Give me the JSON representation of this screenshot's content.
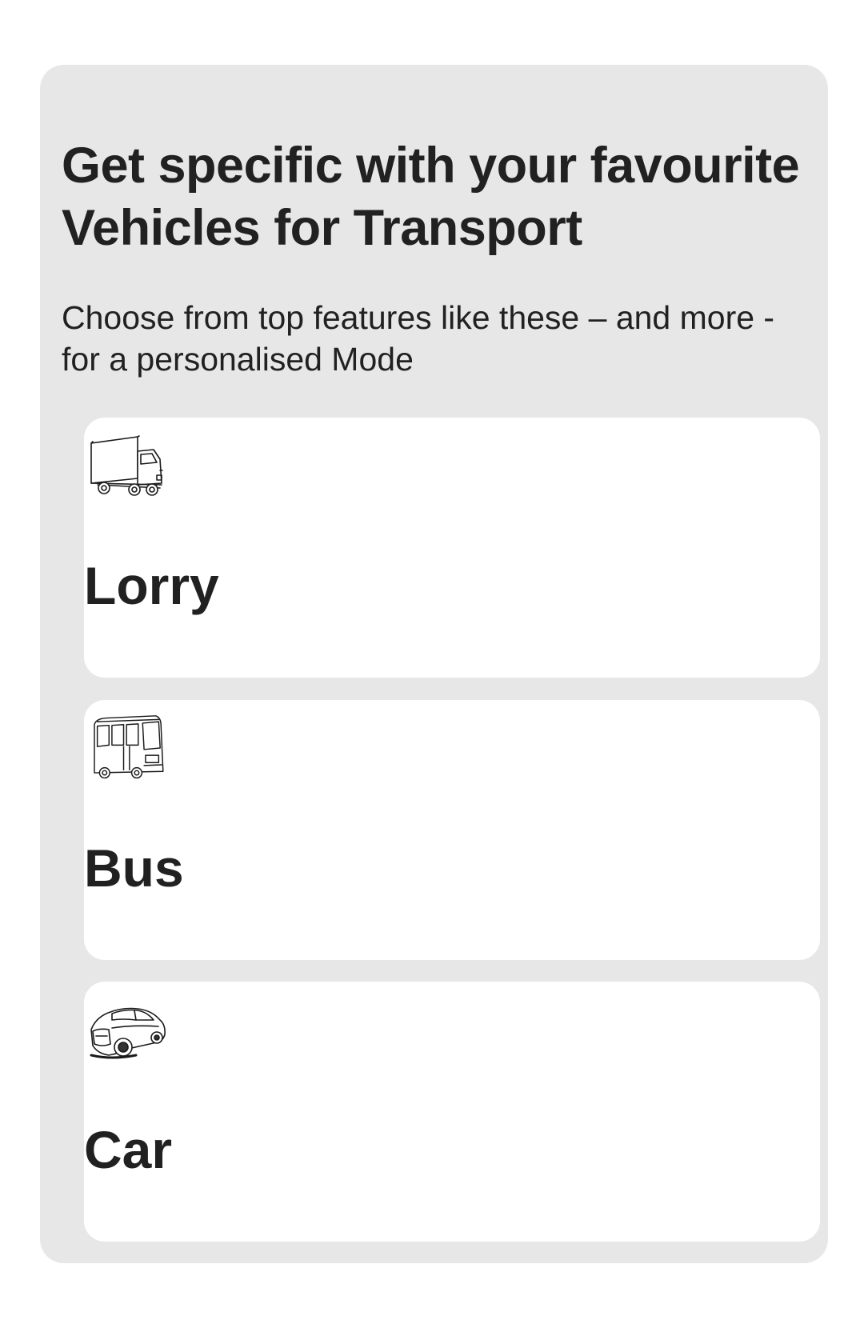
{
  "section": {
    "title": "Get specific with your favourite Vehicles for Transport",
    "subtitle": "Choose from top features like these – and more - for a personalised Mode"
  },
  "vehicles": [
    {
      "label": "Lorry",
      "icon": "lorry-icon"
    },
    {
      "label": "Bus",
      "icon": "bus-icon"
    },
    {
      "label": "Car",
      "icon": "car-icon"
    }
  ],
  "colors": {
    "page_background": "#ffffff",
    "panel_background": "#e7e7e7",
    "card_background": "#ffffff",
    "text": "#212121"
  }
}
